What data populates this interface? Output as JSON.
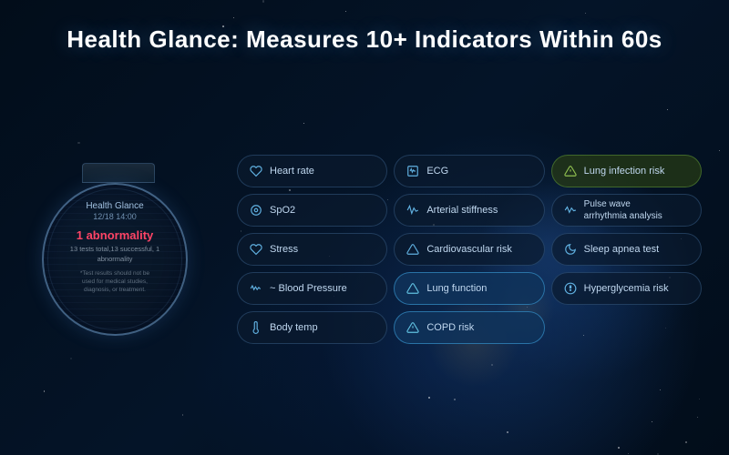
{
  "title": "Health Glance: Measures 10+ Indicators Within 60s",
  "watch": {
    "label": "Health Glance",
    "date": "12/18 14:00",
    "abnormality": "1 abnormality",
    "sub": "13 tests total,13 successful, 1\nabnormality",
    "note": "*Test results should not be\nused for medical studies,\ndiagnosis, or treatment."
  },
  "indicators": [
    {
      "id": "heart-rate",
      "icon": "♡",
      "label": "Heart rate",
      "col": 1,
      "row": 1,
      "active": false
    },
    {
      "id": "ecg",
      "icon": "〜",
      "label": "ECG",
      "col": 2,
      "row": 1,
      "active": false
    },
    {
      "id": "lung-infection",
      "icon": "△",
      "label": "Lung infection risk",
      "col": 3,
      "row": 1,
      "active": true
    },
    {
      "id": "spo2",
      "icon": "◎",
      "label": "SpO2",
      "col": 1,
      "row": 2,
      "active": false
    },
    {
      "id": "arterial",
      "icon": "⟨⟩",
      "label": "Arterial stiffness",
      "col": 2,
      "row": 2,
      "active": false
    },
    {
      "id": "pulse-wave",
      "icon": "〜",
      "label": "Pulse wave arrhythmia analysis",
      "col": 3,
      "row": 2,
      "active": false
    },
    {
      "id": "stress",
      "icon": "♡",
      "label": "Stress",
      "col": 1,
      "row": 3,
      "active": false
    },
    {
      "id": "cardiovascular",
      "icon": "△",
      "label": "Cardiovascular risk",
      "col": 2,
      "row": 3,
      "active": false
    },
    {
      "id": "sleep-apnea",
      "icon": "☽",
      "label": "Sleep apnea test",
      "col": 3,
      "row": 3,
      "active": false
    },
    {
      "id": "blood-pressure",
      "icon": "〜",
      "label": "Blood Pressure",
      "col": 1,
      "row": 4,
      "active": false
    },
    {
      "id": "lung-function",
      "icon": "△",
      "label": "Lung function",
      "col": 2,
      "row": 4,
      "active": false
    },
    {
      "id": "hyperglycemia",
      "icon": "❧",
      "label": "Hyperglycemia risk",
      "col": 3,
      "row": 4,
      "active": false
    },
    {
      "id": "body-temp",
      "icon": "♨",
      "label": "Body temp",
      "col": 1,
      "row": 5,
      "active": false
    },
    {
      "id": "copd",
      "icon": "△",
      "label": "COPD risk",
      "col": 2,
      "row": 5,
      "active": false
    }
  ]
}
